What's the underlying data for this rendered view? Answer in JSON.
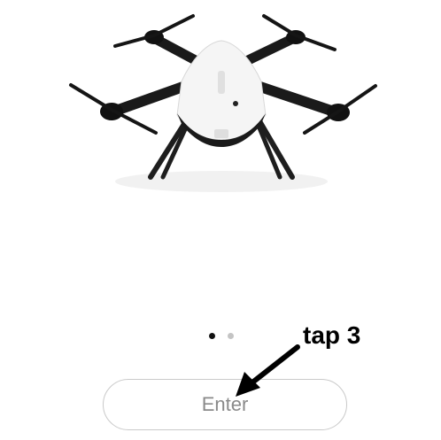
{
  "pager": {
    "dots": [
      {
        "color": "#111111"
      },
      {
        "color": "#c4c4c4"
      }
    ]
  },
  "enter_button": {
    "label": "Enter",
    "text_color": "#8a8a8a"
  },
  "annotation": {
    "label": "tap 3"
  },
  "colors": {
    "drone_body": "#f4f4f4",
    "drone_frame": "#1a1a1a",
    "border": "#c9c9c9"
  }
}
